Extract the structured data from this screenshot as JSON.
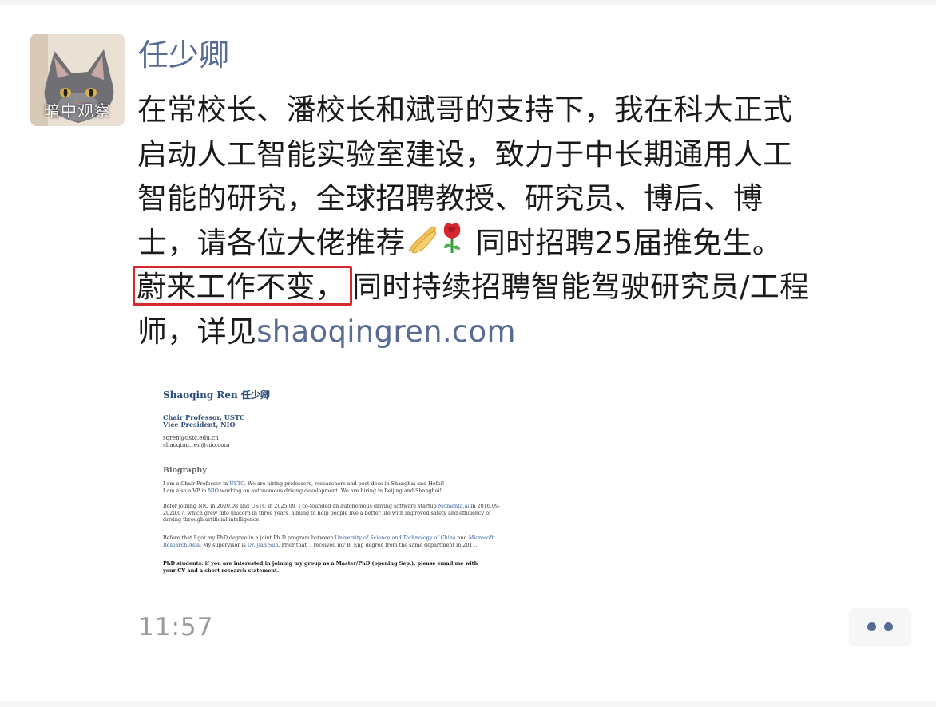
{
  "post": {
    "avatar_caption": "暗中观察",
    "username": "任少卿",
    "lines": [
      "在常校长、潘校长和斌哥的支持下，我在科大正式",
      "启动人工智能实验室建设，致力于中长期通用人工",
      "智能的研究，全球招聘教授、研究员、博后、博",
      "士，请各位大佬推荐"
    ],
    "line4_tail": " 同时招聘25届推免生。",
    "highlighted_text": "蔚来工作不变，",
    "line5_tail": "同时持续招聘智能驾驶研究员/工程",
    "line6_prefix": "师，详见",
    "link_text": "shaoqingren.com",
    "emojis": [
      "praying-hands-icon",
      "rose-icon"
    ],
    "timestamp": "11:57"
  },
  "embed": {
    "name": "Shaoqing Ren 任少卿",
    "title1": "Chair Professor, USTC",
    "title2": "Vice President, NIO",
    "email1": "sqren@ustc.edu.cn",
    "email2": "shaoqing.ren@nio.com",
    "heading": "Biography",
    "p1_a": "I am a Chair Professor in ",
    "p1_link": "USTC",
    "p1_b": ". We are hiring professors, researchers and post-docs in Shanghai and Hefei!",
    "p2_a": "I am also a VP in ",
    "p2_link": "NIO",
    "p2_b": " working on autonomous driving development. We are hiring in Beijing and Shanghai!",
    "p3_a": "Befor joining NIO in 2020.08 and USTC in 2025.09, I co-founded an autonomous driving software startup ",
    "p3_link": "Momenta.ai",
    "p3_b": " in 2016.09-",
    "p3_c": "2020.07, which grew into unicorn in three years, aiming to help people live a better life with improved safety and efficiency of",
    "p3_d": "driving through artificial intelligence.",
    "p4_a": "Before that I got my PhD degree in a joint Ph.D program between ",
    "p4_link1": "University of Science and Technology of China",
    "p4_b": " and ",
    "p4_link2": "Microsoft",
    "p4_c": "Research Asia",
    "p4_d": ". My supervisor is ",
    "p4_link3": "Dr. Jian Sun",
    "p4_e": ". Prior that, I received my B. Eng degree from the same department in 2011.",
    "p5_a": "PhD students: if you are interested in joining my group as a Master/PhD (opening Sep.), please email me with",
    "p5_b": "your CV and a short research statement."
  },
  "colors": {
    "name_blue": "#576b95",
    "highlight_red": "#d9262b",
    "text": "#1a1a1a",
    "timestamp": "#9a9a9a"
  }
}
